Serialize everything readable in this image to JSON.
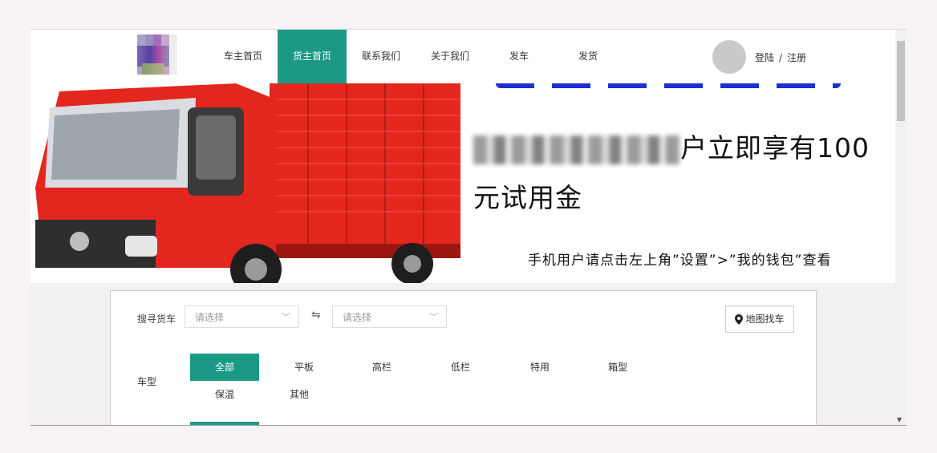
{
  "nav": {
    "items": [
      "车主首页",
      "货主首页",
      "联系我们",
      "关于我们",
      "发车",
      "发货"
    ],
    "active_index": 1
  },
  "auth": {
    "login": "登陆",
    "separator": "/",
    "register": "注册"
  },
  "banner": {
    "line1_suffix": "户立即享有100",
    "line2": "元试用金",
    "line3": "手机用户请点击左上角”设置”>”我的钱包”查看"
  },
  "search": {
    "label": "搜寻货车",
    "from_placeholder": "请选择",
    "swap_icon": "⇋",
    "to_placeholder": "请选择",
    "map_button": "地图找车"
  },
  "vehicle_type": {
    "label": "车型",
    "options": [
      "全部",
      "平板",
      "高栏",
      "低栏",
      "特用",
      "箱型",
      "保温",
      "其他"
    ],
    "active_index": 0
  },
  "colors": {
    "accent": "#1b9986",
    "banner_blue": "#1e2fd0",
    "truck_red": "#e3271e"
  }
}
